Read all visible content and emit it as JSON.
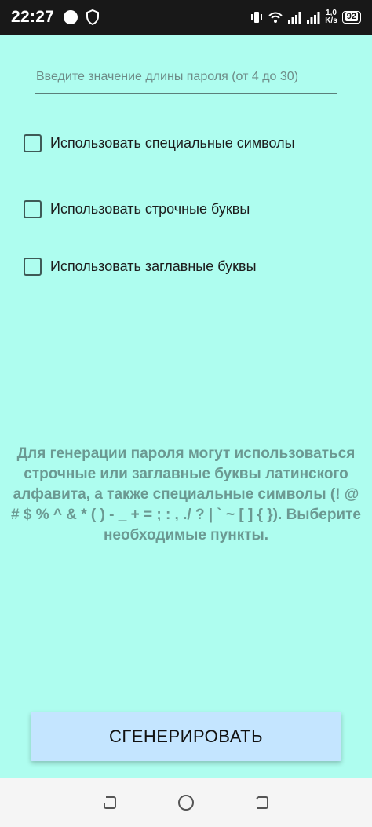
{
  "status_bar": {
    "time": "22:27",
    "speed_value": "1,0",
    "speed_unit": "K/s",
    "battery": "92"
  },
  "length_input": {
    "placeholder": "Введите значение длины пароля (от 4 до 30)",
    "value": ""
  },
  "options": [
    {
      "label": "Использовать специальные символы",
      "checked": false
    },
    {
      "label": "Использовать строчные буквы",
      "checked": false
    },
    {
      "label": "Использовать заглавные буквы",
      "checked": false
    }
  ],
  "info_text": "Для генерации пароля могут использоваться строчные или заглавные буквы латинского алфавита, а также специальные символы (! @ # $ % ^ & * ( ) - _ + = ; : , ./ ? | ` ~ [ ] { }). Выберите необходимые пункты.",
  "generate_button": {
    "label": "СГЕНЕРИРОВАТЬ"
  },
  "icons": {
    "shield": "shield-icon",
    "vibrate": "vibrate-icon",
    "wifi": "wifi-icon",
    "signal": "signal-icon",
    "recents": "recents-icon",
    "home": "home-icon",
    "back": "back-icon"
  },
  "colors": {
    "background": "#aefdef",
    "button": "#c4e5ff",
    "info_text": "#6b9992"
  }
}
